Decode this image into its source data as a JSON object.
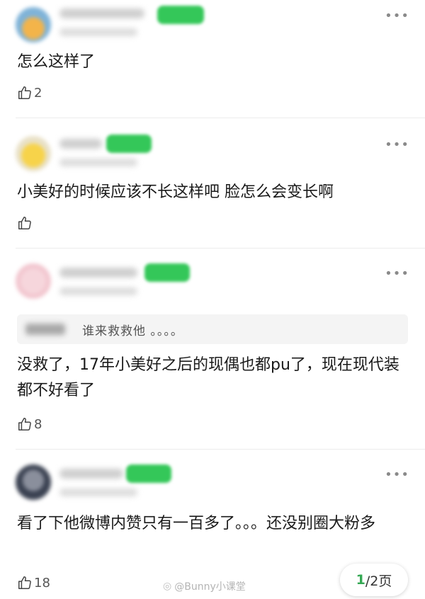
{
  "comments": [
    {
      "text": "怎么这样了",
      "likes": "2",
      "quote": null
    },
    {
      "text": "小美好的时候应该不长这样吧 脸怎么会变长啊",
      "likes": "",
      "quote": null
    },
    {
      "text": "没救了，17年小美好之后的现偶也都pu了，现在现代装都不好看了",
      "likes": "8",
      "quote": {
        "text": "谁来救救他 。。。。"
      }
    },
    {
      "text": "看了下他微博内赞只有一百多了。。。还没别圈大粉多",
      "likes": "18",
      "quote": null
    }
  ],
  "more_label": "•••",
  "pager": {
    "current": "1",
    "total": "/2页"
  },
  "watermark": {
    "text": "@Bunny小课堂"
  },
  "colors": {
    "accent": "#34c759",
    "page_current": "#34a853"
  }
}
